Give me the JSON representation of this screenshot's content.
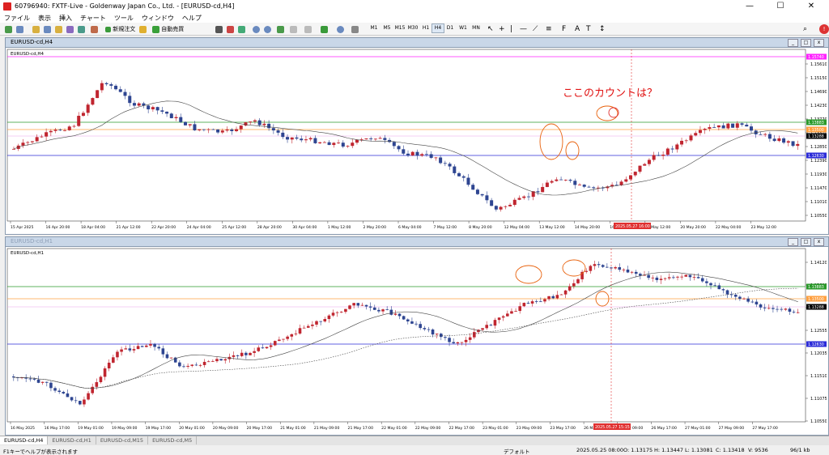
{
  "window": {
    "title": "60796940: FXTF-Live - Goldenway Japan Co., Ltd. - [EURUSD-cd,H4]",
    "min": "—",
    "max": "☐",
    "close": "✕"
  },
  "menu": [
    "ファイル",
    "表示",
    "挿入",
    "チャート",
    "ツール",
    "ウィンドウ",
    "ヘルプ"
  ],
  "toolbar": {
    "new_order": "新規注文",
    "auto_trade": "自動売買",
    "timeframes": [
      "M1",
      "M5",
      "M15",
      "M30",
      "H1",
      "H4",
      "D1",
      "W1",
      "MN"
    ],
    "active_tf": "H4"
  },
  "colors": {
    "bull": "#c0252f",
    "bear": "#2e4591",
    "magenta": "#ff22ff",
    "green": "#2a9a2a",
    "orange": "#ffa040",
    "blue": "#2b2bd8",
    "pink": "#e8a0e8",
    "ma": "#444444",
    "annot": "#e8600a",
    "redline": "#e03030"
  },
  "chart_h4": {
    "tab_title": "EURUSD-cd,H4",
    "inner_label": "EURUSD-cd,H4",
    "annotation": "ここのカウントは？",
    "y_ticks": [
      "1.15610",
      "1.15150",
      "1.14690",
      "1.14230",
      "1.13770",
      "1.13310",
      "1.12850",
      "1.12390",
      "1.11930",
      "1.11470",
      "1.11010",
      "1.10550"
    ],
    "tags": {
      "magenta": "1.15740",
      "green": "1.13883",
      "orange": "1.13500",
      "black": "1.13288",
      "blue": "1.12630"
    },
    "time_labels": [
      "15 Apr 2025",
      "16 Apr 20:00",
      "18 Apr 04:00",
      "21 Apr 12:00",
      "22 Apr 20:00",
      "24 Apr 04:00",
      "25 Apr 12:00",
      "28 Apr 20:00",
      "30 Apr 04:00",
      "1 May 12:00",
      "2 May 20:00",
      "6 May 04:00",
      "7 May 12:00",
      "8 May 20:00",
      "12 May 04:00",
      "13 May 12:00",
      "14 May 20:00",
      "16 May 04:00",
      "19 May 12:00",
      "20 May 20:00",
      "22 May 04:00",
      "23 May 12:00"
    ],
    "cursor_time": "2025.05.27 16:00"
  },
  "chart_h1": {
    "tab_title": "EURUSD-cd,H1",
    "inner_label": "EURUSD-cd,H1",
    "y_ticks": [
      "1.14120",
      "1.13600",
      "1.13075",
      "1.12555",
      "1.12035",
      "1.11510",
      "1.11075",
      "1.10550"
    ],
    "tags": {
      "green": "1.13883",
      "orange": "1.13500",
      "black": "1.13288",
      "blue": "1.12630"
    },
    "time_labels": [
      "16 May 2025",
      "16 May 17:00",
      "19 May 01:00",
      "19 May 09:00",
      "19 May 17:00",
      "20 May 01:00",
      "20 May 09:00",
      "20 May 17:00",
      "21 May 01:00",
      "21 May 09:00",
      "21 May 17:00",
      "22 May 01:00",
      "22 May 09:00",
      "22 May 17:00",
      "23 May 01:00",
      "23 May 09:00",
      "23 May 17:00",
      "26 May 01:00",
      "26 May 09:00",
      "26 May 17:00",
      "27 May 01:00",
      "27 May 09:00",
      "27 May 17:00"
    ],
    "cursor_time": "2025.05.27 15:15"
  },
  "tabs": [
    "EURUSD-cd,H4",
    "EURUSD-cd,H1",
    "EURUSD-cd,M15",
    "EURUSD-cd,M5"
  ],
  "status": {
    "left": "F1キーでヘルプが表示されます",
    "profile": "デフォルト",
    "datetime": "2025.05.25 08:00",
    "o": "O: 1.13175",
    "h": "H: 1.13447",
    "l": "L: 1.13081",
    "c": "C: 1.13418",
    "v": "V: 9536",
    "conn": "96/1 kb"
  }
}
